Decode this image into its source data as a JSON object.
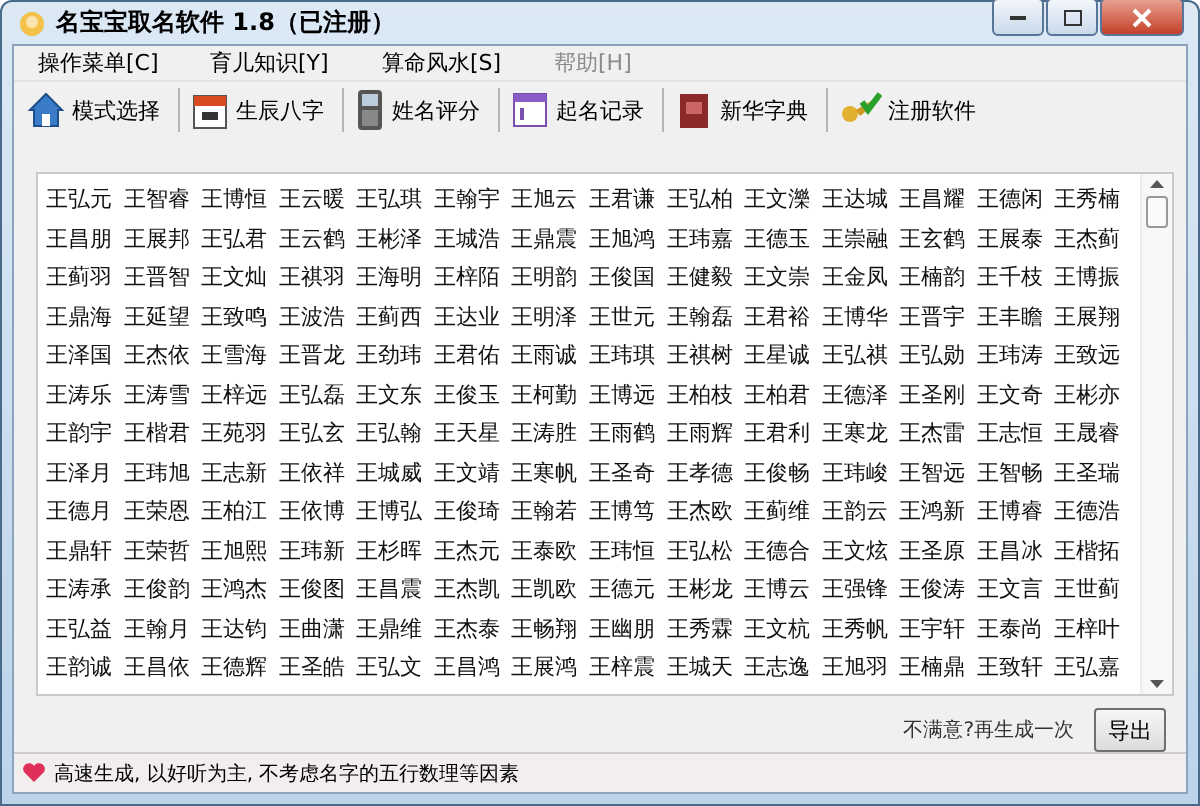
{
  "window": {
    "title": "名宝宝取名软件 1.8（已注册）"
  },
  "menu": [
    {
      "label": "操作菜单[C]",
      "disabled": false
    },
    {
      "label": "育儿知识[Y]",
      "disabled": false
    },
    {
      "label": "算命风水[S]",
      "disabled": false
    },
    {
      "label": "帮助[H]",
      "disabled": true
    }
  ],
  "toolbar": [
    {
      "kind": "house",
      "label": "模式选择"
    },
    {
      "kind": "calendar",
      "label": "生辰八字"
    },
    {
      "kind": "phone",
      "label": "姓名评分"
    },
    {
      "kind": "record",
      "label": "起名记录"
    },
    {
      "kind": "dictionary",
      "label": "新华字典"
    },
    {
      "kind": "keys",
      "label": "注册软件"
    }
  ],
  "names": [
    [
      "王弘元",
      "王智睿",
      "王博恒",
      "王云暖",
      "王弘琪",
      "王翰宇",
      "王旭云",
      "王君谦",
      "王弘柏",
      "王文濼",
      "王达城",
      "王昌耀",
      "王德闲",
      "王秀楠"
    ],
    [
      "王昌朋",
      "王展邦",
      "王弘君",
      "王云鹤",
      "王彬泽",
      "王城浩",
      "王鼎震",
      "王旭鸿",
      "王玮嘉",
      "王德玉",
      "王崇融",
      "王玄鹤",
      "王展泰",
      "王杰蓟"
    ],
    [
      "王蓟羽",
      "王晋智",
      "王文灿",
      "王祺羽",
      "王海明",
      "王梓陌",
      "王明韵",
      "王俊国",
      "王健毅",
      "王文崇",
      "王金凤",
      "王楠韵",
      "王千枝",
      "王博振"
    ],
    [
      "王鼎海",
      "王延望",
      "王致鸣",
      "王波浩",
      "王蓟西",
      "王达业",
      "王明泽",
      "王世元",
      "王翰磊",
      "王君裕",
      "王博华",
      "王晋宇",
      "王丰瞻",
      "王展翔"
    ],
    [
      "王泽国",
      "王杰依",
      "王雪海",
      "王晋龙",
      "王劲玮",
      "王君佑",
      "王雨诚",
      "王玮琪",
      "王祺树",
      "王星诚",
      "王弘祺",
      "王弘勋",
      "王玮涛",
      "王致远"
    ],
    [
      "王涛乐",
      "王涛雪",
      "王梓远",
      "王弘磊",
      "王文东",
      "王俊玉",
      "王柯勤",
      "王博远",
      "王柏枝",
      "王柏君",
      "王德泽",
      "王圣刚",
      "王文奇",
      "王彬亦"
    ],
    [
      "王韵宇",
      "王楷君",
      "王苑羽",
      "王弘玄",
      "王弘翰",
      "王天星",
      "王涛胜",
      "王雨鹤",
      "王雨辉",
      "王君利",
      "王寒龙",
      "王杰雷",
      "王志恒",
      "王晟睿"
    ],
    [
      "王泽月",
      "王玮旭",
      "王志新",
      "王依祥",
      "王城威",
      "王文靖",
      "王寒帆",
      "王圣奇",
      "王孝德",
      "王俊畅",
      "王玮峻",
      "王智远",
      "王智畅",
      "王圣瑞"
    ],
    [
      "王德月",
      "王荣恩",
      "王柏江",
      "王依博",
      "王博弘",
      "王俊琦",
      "王翰若",
      "王博笃",
      "王杰欧",
      "王蓟维",
      "王韵云",
      "王鸿新",
      "王博睿",
      "王德浩"
    ],
    [
      "王鼎轩",
      "王荣哲",
      "王旭熙",
      "王玮新",
      "王杉晖",
      "王杰元",
      "王泰欧",
      "王玮恒",
      "王弘松",
      "王德合",
      "王文炫",
      "王圣原",
      "王昌冰",
      "王楷拓"
    ],
    [
      "王涛承",
      "王俊韵",
      "王鸿杰",
      "王俊图",
      "王昌震",
      "王杰凯",
      "王凯欧",
      "王德元",
      "王彬龙",
      "王博云",
      "王强锋",
      "王俊涛",
      "王文言",
      "王世蓟"
    ],
    [
      "王弘益",
      "王翰月",
      "王达钧",
      "王曲潇",
      "王鼎维",
      "王杰泰",
      "王畅翔",
      "王幽朋",
      "王秀霖",
      "王文杭",
      "王秀帆",
      "王宇轩",
      "王泰尚",
      "王梓叶"
    ],
    [
      "王韵诚",
      "王昌依",
      "王德辉",
      "王圣皓",
      "王弘文",
      "王昌鸿",
      "王展鸿",
      "王梓震",
      "王城天",
      "王志逸",
      "王旭羽",
      "王楠鼎",
      "王致轩",
      "王弘嘉"
    ]
  ],
  "regenerate_link": "不满意?再生成一次",
  "export_button": "导出",
  "status_bar": "高速生成, 以好听为主, 不考虑名字的五行数理等因素"
}
